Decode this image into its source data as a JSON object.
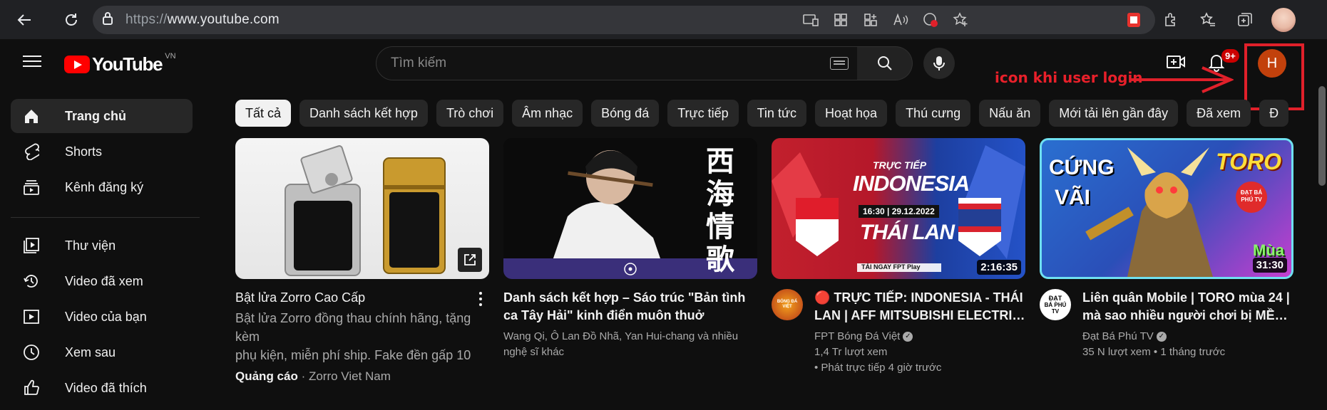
{
  "browser": {
    "url_scheme": "https://",
    "url_host": "www.youtube.com"
  },
  "header": {
    "logo_text": "YouTube",
    "country_code": "VN",
    "search_placeholder": "Tìm kiếm",
    "notification_count": "9+",
    "avatar_letter": "H",
    "annotation": "icon khi user login"
  },
  "sidebar": {
    "items": [
      {
        "label": "Trang chủ",
        "icon": "home-icon"
      },
      {
        "label": "Shorts",
        "icon": "shorts-icon"
      },
      {
        "label": "Kênh đăng ký",
        "icon": "subscriptions-icon"
      },
      {
        "label": "Thư viện",
        "icon": "library-icon"
      },
      {
        "label": "Video đã xem",
        "icon": "history-icon"
      },
      {
        "label": "Video của bạn",
        "icon": "your-videos-icon"
      },
      {
        "label": "Xem sau",
        "icon": "clock-icon"
      },
      {
        "label": "Video đã thích",
        "icon": "thumbs-up-icon"
      }
    ]
  },
  "chips": [
    "Tất cả",
    "Danh sách kết hợp",
    "Trò chơi",
    "Âm nhạc",
    "Bóng đá",
    "Trực tiếp",
    "Tin tức",
    "Hoạt họa",
    "Thú cưng",
    "Nấu ăn",
    "Mới tải lên gần đây",
    "Đã xem",
    "Đ"
  ],
  "videos": [
    {
      "title": "Bật lửa Zorro Cao Cấp",
      "desc_line1": "Bật lửa Zorro đồng thau chính hãng, tặng kèm",
      "desc_line2": "phụ kiện, miễn phí ship. Fake đền gấp 10",
      "ad_label": "Quảng cáo",
      "sep": " · ",
      "channel": "Zorro Viet Nam"
    },
    {
      "title_line1": "Danh sách kết hợp – Sáo trúc \"Bản tình",
      "title_line2": "ca Tây Hải\" kinh điển muôn thuở",
      "meta_line1": "Wang Qi, Ô Lan Đồ Nhã, Yan Hui-chang và nhiều",
      "meta_line2": "nghệ sĩ khác",
      "thumb_text": "西海情歌"
    },
    {
      "title_line1": "🔴 TRỰC TIẾP: INDONESIA - THÁI",
      "title_line2": "LAN | AFF MITSUBISHI ELECTRI…",
      "channel": "FPT Bóng Đá Việt",
      "views": "1,4 Tr lượt xem",
      "when": "• Phát trực tiếp 4 giờ trước",
      "duration": "2:16:35",
      "thumb_top": "TRỰC TIẾP",
      "thumb_team1": "INDONESIA",
      "thumb_time": "16:30 | 29.12.2022",
      "thumb_team2": "THÁI LAN",
      "thumb_foot": "TẢI NGAY  FPT Play",
      "avatar_text": "BÓNG ĐÁ VIỆT"
    },
    {
      "title_line1": "Liên quân Mobile | TORO mùa 24 |",
      "title_line2": "mà sao nhiều người chơi bị MỀ…",
      "channel": "Đạt Bá Phú TV",
      "views": "35 N lượt xem",
      "sep": " • ",
      "when": "1 tháng trước",
      "duration": "31:30",
      "thumb_left1": "CỨNG",
      "thumb_left2": "VÃI",
      "thumb_right": "TORO",
      "thumb_badge": "ĐẠT BÁ PHÚ TV",
      "thumb_season": "Mùa",
      "avatar_text1": "ĐẠT",
      "avatar_text2": "BÁ PHÚ",
      "avatar_text3": "TV"
    }
  ],
  "colors": {
    "background": "#0f0f0f",
    "brand_red": "#ff0000",
    "annotation_red": "#e0202a",
    "avatar": "#c2410c"
  }
}
